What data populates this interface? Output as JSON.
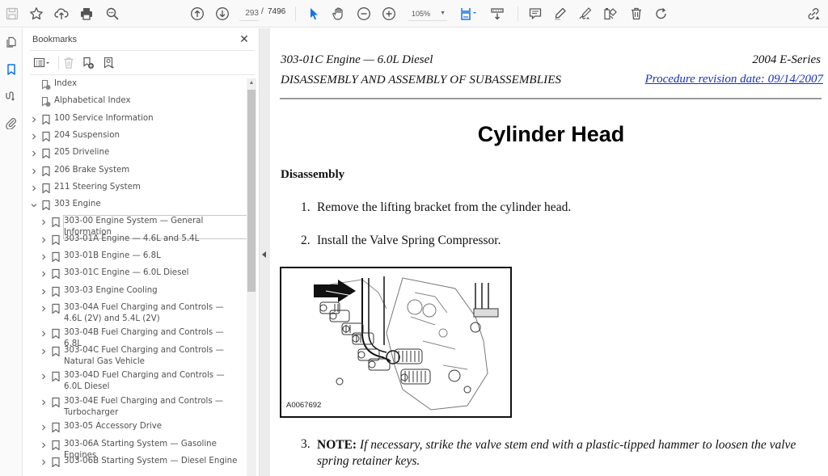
{
  "toolbar": {
    "left_icons": [
      "save-icon",
      "star-icon",
      "upload-cloud-icon",
      "print-icon",
      "find-zoom-icon"
    ],
    "nav_icons": [
      "previous-page-icon",
      "next-page-icon"
    ],
    "current_page": "293",
    "page_separator": "/",
    "total_pages": "7496",
    "tool_icons": [
      "select-cursor-icon",
      "hand-icon",
      "zoom-out-icon",
      "zoom-in-icon"
    ],
    "zoom_level": "105%",
    "view_icons": [
      "page-fit-icon",
      "scroll-mode-icon"
    ],
    "annotate_icons": [
      "comment-icon",
      "highlight-icon",
      "sign-icon",
      "stamp-icon",
      "delete-icon",
      "rotate-icon"
    ],
    "share_icon": "share-link-icon",
    "accent_color": "#1473e6"
  },
  "rail": {
    "items": [
      {
        "name": "page-thumbnails",
        "icon": "pages-icon",
        "active": false
      },
      {
        "name": "bookmarks",
        "icon": "bookmark-icon",
        "active": true
      },
      {
        "name": "signatures",
        "icon": "signature-icon",
        "active": false
      },
      {
        "name": "attachments",
        "icon": "paperclip-icon",
        "active": false
      }
    ]
  },
  "bookmarks_panel": {
    "title": "Bookmarks",
    "close_label": "✕",
    "tools": [
      "options-list-icon",
      "delete-bookmark-icon",
      "new-bookmark-icon",
      "bookmark-search-icon"
    ],
    "items": [
      {
        "label": "Index",
        "level": 0,
        "expandable": false,
        "expanded": false,
        "special": true
      },
      {
        "label": "Alphabetical Index",
        "level": 0,
        "expandable": false,
        "expanded": false,
        "special": true
      },
      {
        "label": "100 Service Information",
        "level": 0,
        "expandable": true,
        "expanded": false
      },
      {
        "label": "204 Suspension",
        "level": 0,
        "expandable": true,
        "expanded": false
      },
      {
        "label": "205 Driveline",
        "level": 0,
        "expandable": true,
        "expanded": false
      },
      {
        "label": "206 Brake System",
        "level": 0,
        "expandable": true,
        "expanded": false
      },
      {
        "label": "211 Steering System",
        "level": 0,
        "expandable": true,
        "expanded": false
      },
      {
        "label": "303 Engine",
        "level": 0,
        "expandable": true,
        "expanded": true
      },
      {
        "label": "303-00 Engine System — General Information",
        "level": 1,
        "expandable": true,
        "expanded": false,
        "selected": true
      },
      {
        "label": "303-01A Engine — 4.6L and 5.4L",
        "level": 1,
        "expandable": true,
        "expanded": false
      },
      {
        "label": "303-01B Engine — 6.8L",
        "level": 1,
        "expandable": true,
        "expanded": false
      },
      {
        "label": "303-01C Engine — 6.0L Diesel",
        "level": 1,
        "expandable": true,
        "expanded": false
      },
      {
        "label": "303-03 Engine Cooling",
        "level": 1,
        "expandable": true,
        "expanded": false
      },
      {
        "label": "303-04A Fuel Charging and Controls — 4.6L (2V) and 5.4L (2V)",
        "level": 1,
        "expandable": true,
        "expanded": false
      },
      {
        "label": "303-04B Fuel Charging and Controls — 6.8L",
        "level": 1,
        "expandable": true,
        "expanded": false
      },
      {
        "label": "303-04C Fuel Charging and Controls — Natural Gas Vehicle",
        "level": 1,
        "expandable": true,
        "expanded": false
      },
      {
        "label": "303-04D Fuel Charging and Controls — 6.0L Diesel",
        "level": 1,
        "expandable": true,
        "expanded": false
      },
      {
        "label": "303-04E Fuel Charging and Controls — Turbocharger",
        "level": 1,
        "expandable": true,
        "expanded": false
      },
      {
        "label": "303-05 Accessory Drive",
        "level": 1,
        "expandable": true,
        "expanded": false
      },
      {
        "label": "303-06A Starting System — Gasoline Engines",
        "level": 1,
        "expandable": true,
        "expanded": false
      },
      {
        "label": "303-06B Starting System — Diesel Engine",
        "level": 1,
        "expandable": true,
        "expanded": false
      }
    ]
  },
  "document": {
    "header_left_line1": "303-01C Engine — 6.0L Diesel",
    "header_left_line2": "DISASSEMBLY AND ASSEMBLY OF SUBASSEMBLIES",
    "header_right_line1": "2004 E-Series",
    "header_right_link": "Procedure revision date: 09/14/2007",
    "title": "Cylinder Head",
    "section": "Disassembly",
    "steps": [
      {
        "num": "1.",
        "text": "Remove the lifting bracket from the cylinder head."
      },
      {
        "num": "2.",
        "text": "Install the Valve Spring Compressor."
      },
      {
        "num": "3.",
        "note_label": "NOTE:",
        "text": " If necessary, strike the valve stem end with a plastic-tipped hammer to loosen the valve spring retainer keys."
      }
    ],
    "figure_id": "A0067692",
    "link_color": "#1a33b4"
  }
}
